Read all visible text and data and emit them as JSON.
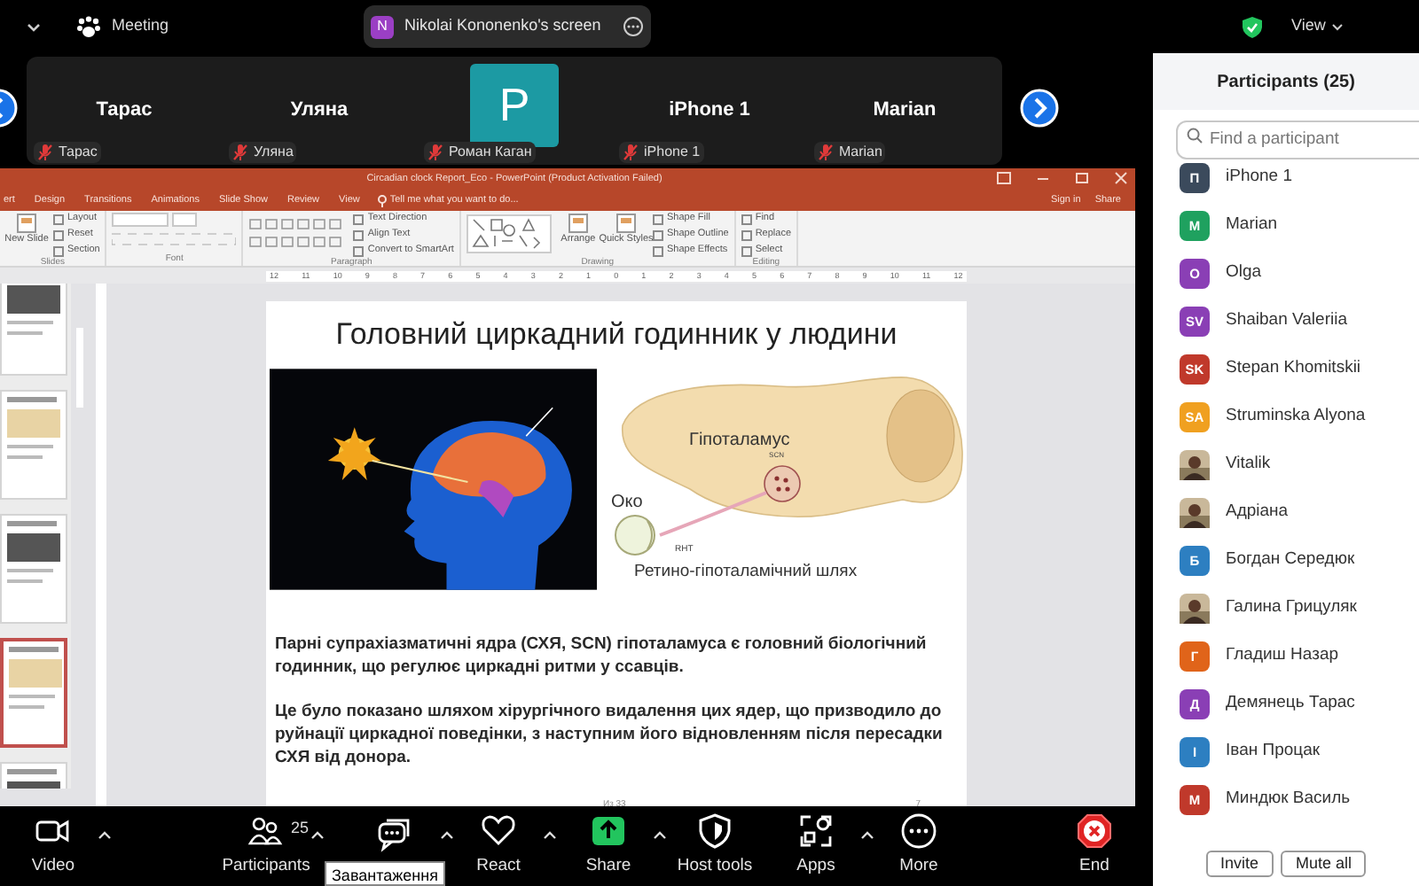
{
  "top_bar": {
    "meeting_label": "Meeting",
    "share_banner": {
      "initial": "N",
      "title": "Nikolai Kononenko's screen"
    },
    "view_label": "View"
  },
  "gallery": [
    {
      "kind": "name",
      "name": "Тарас",
      "label": "Тарас",
      "muted": true
    },
    {
      "kind": "name",
      "name": "Уляна",
      "label": "Уляна",
      "muted": true
    },
    {
      "kind": "avatar",
      "initial": "P",
      "label": "Роман Каган",
      "muted": true
    },
    {
      "kind": "name",
      "name": "iPhone 1",
      "label": "iPhone 1",
      "muted": true
    },
    {
      "kind": "name",
      "name": "Marian",
      "label": "Marian",
      "muted": true
    }
  ],
  "powerpoint": {
    "title": "Circadian clock Report_Eco - PowerPoint (Product Activation Failed)",
    "tabs": [
      "ert",
      "Design",
      "Transitions",
      "Animations",
      "Slide Show",
      "Review",
      "View"
    ],
    "tell_me": "Tell me what you want to do...",
    "sign_in": "Sign in",
    "share": "Share",
    "ribbon_groups": [
      {
        "label": "Slides",
        "items": [
          {
            "kind": "large",
            "label": "New Slide"
          },
          {
            "kind": "small",
            "label": "Layout"
          },
          {
            "kind": "small",
            "label": "Reset"
          },
          {
            "kind": "small",
            "label": "Section"
          }
        ]
      },
      {
        "label": "Font",
        "items": [
          {
            "kind": "font_controls"
          }
        ]
      },
      {
        "label": "Paragraph",
        "items": [
          {
            "kind": "tools"
          },
          {
            "kind": "small",
            "label": "Text Direction"
          },
          {
            "kind": "small",
            "label": "Align Text"
          },
          {
            "kind": "small",
            "label": "Convert to SmartArt"
          }
        ]
      },
      {
        "label": "Drawing",
        "items": [
          {
            "kind": "shapes"
          },
          {
            "kind": "large",
            "label": "Arrange"
          },
          {
            "kind": "large",
            "label": "Quick Styles"
          },
          {
            "kind": "small",
            "label": "Shape Fill"
          },
          {
            "kind": "small",
            "label": "Shape Outline"
          },
          {
            "kind": "small",
            "label": "Shape Effects"
          }
        ]
      },
      {
        "label": "Editing",
        "items": [
          {
            "kind": "small",
            "label": "Find"
          },
          {
            "kind": "small",
            "label": "Replace"
          },
          {
            "kind": "small",
            "label": "Select"
          }
        ]
      }
    ],
    "ruler": [
      "12",
      "11",
      "10",
      "9",
      "8",
      "7",
      "6",
      "5",
      "4",
      "3",
      "2",
      "1",
      "0",
      "1",
      "2",
      "3",
      "4",
      "5",
      "6",
      "7",
      "8",
      "9",
      "10",
      "11",
      "12"
    ],
    "thumbnails": [
      {
        "selected": false
      },
      {
        "selected": false
      },
      {
        "selected": false
      },
      {
        "selected": true
      },
      {
        "selected": false
      }
    ],
    "slide": {
      "title": "Головний циркадний годинник у людини",
      "diagram": {
        "hypothalamus": "Гіпоталамус",
        "scn": "SCN",
        "eye": "Око",
        "rht": "RHT",
        "pathway": "Ретино-гіпоталамічний шлях"
      },
      "paragraphs": [
        "Парні супрахіазматичні ядра (СХЯ, SCN) гіпоталамуса є головний біологічний годинник, що регулює циркадні ритми у ссавців.",
        "Це було показано шляхом хірургічного видалення цих ядер, що призводило до руйнації циркадної поведінки, з наступним його відновленням  після пересадки СХЯ від донора."
      ],
      "footer": "Из 33",
      "page_number": "7"
    }
  },
  "participants": {
    "title": "Participants (25)",
    "search": {
      "placeholder": "Find a participant"
    },
    "list": [
      {
        "kind": "initials",
        "initials": "П",
        "name": "iPhone 1",
        "color": "#3b4a5c"
      },
      {
        "kind": "initials",
        "initials": "M",
        "name": "Marian",
        "color": "#1fa15f"
      },
      {
        "kind": "initials",
        "initials": "O",
        "name": "Olga",
        "color": "#8a3fb5"
      },
      {
        "kind": "initials",
        "initials": "SV",
        "name": "Shaiban Valeriia",
        "color": "#8a3fb5"
      },
      {
        "kind": "initials",
        "initials": "SK",
        "name": "Stepan Khomitskii",
        "color": "#c0392b"
      },
      {
        "kind": "initials",
        "initials": "SA",
        "name": "Struminska Alyona",
        "color": "#f0a020"
      },
      {
        "name": "Vitalik"
      },
      {
        "name": "Адріана"
      },
      {
        "kind": "initials",
        "initials": "Б",
        "name": "Богдан Середюк",
        "color": "#2d7fc1"
      },
      {
        "name": "Галина Грицуляк"
      },
      {
        "kind": "initials",
        "initials": "Г",
        "name": "Гладиш Назар",
        "color": "#e0641a"
      },
      {
        "kind": "initials",
        "initials": "Д",
        "name": "Демянець Тарас",
        "color": "#8a3fb5"
      },
      {
        "kind": "initials",
        "initials": "І",
        "name": "Іван Процак",
        "color": "#2d7fc1"
      },
      {
        "kind": "initials",
        "initials": "М",
        "name": "Миндюк Василь",
        "color": "#c0392b"
      }
    ],
    "buttons": [
      "Invite",
      "Mute all"
    ]
  },
  "toolbar": {
    "items": [
      {
        "label": "Video",
        "caret": true
      },
      {
        "label": "Participants",
        "count": "25",
        "caret": true
      },
      {
        "caret": true
      },
      {
        "label": "React",
        "caret": true
      },
      {
        "label": "Share",
        "caret": true
      },
      {
        "label": "Host tools",
        "caret": false
      },
      {
        "label": "Apps",
        "caret": true
      },
      {
        "label": "More",
        "caret": false
      },
      {
        "label": "End",
        "caret": false
      }
    ],
    "tooltip": "Завантаження"
  }
}
